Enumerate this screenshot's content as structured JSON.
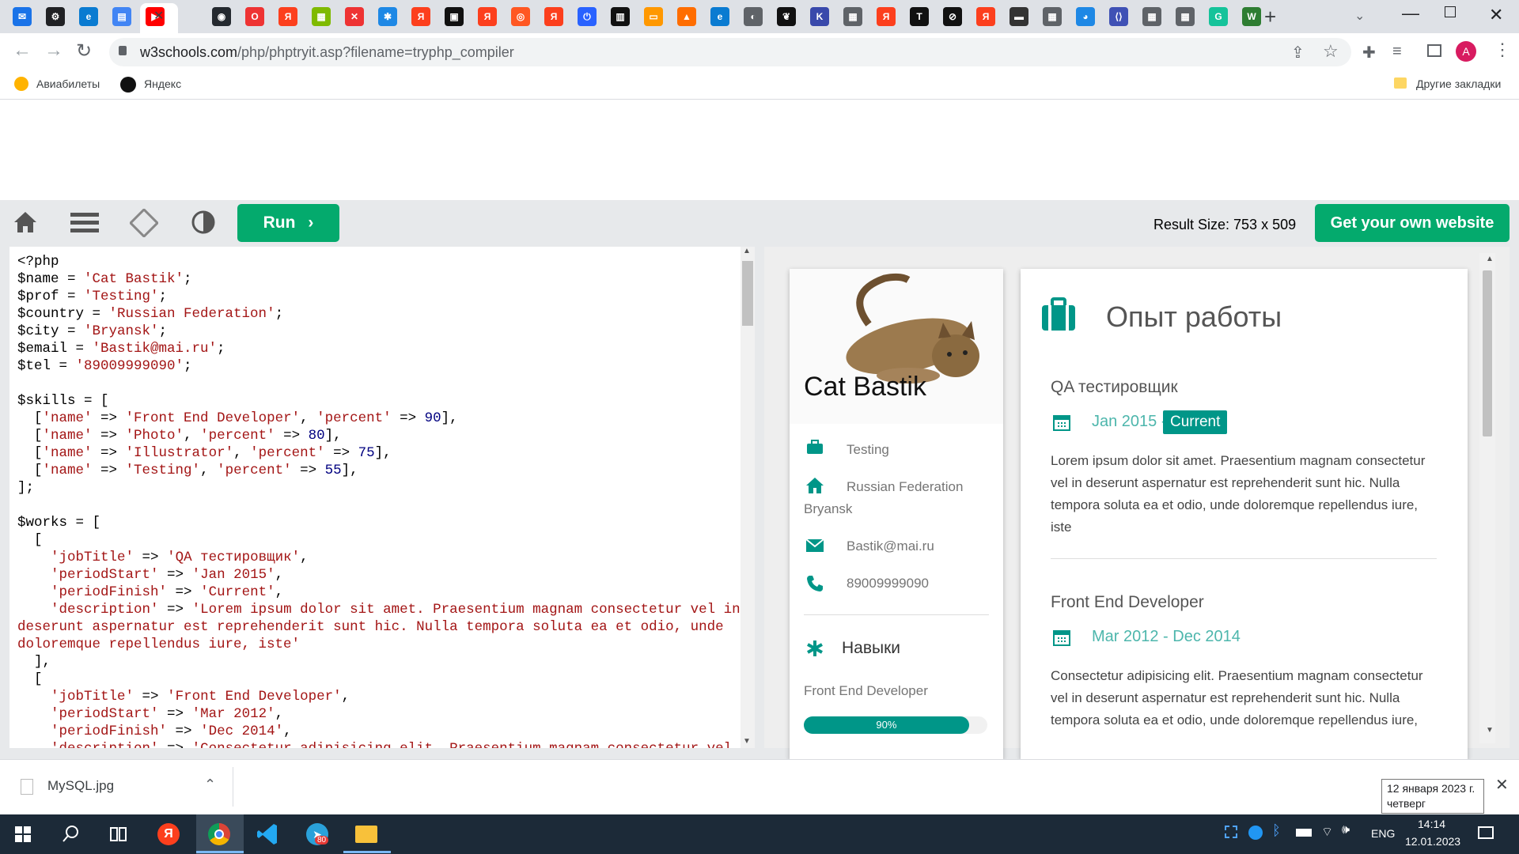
{
  "browser": {
    "url_domain": "w3schools.com",
    "url_path": "/php/phptryit.asp?filename=tryphp_compiler",
    "profile_initial": "A",
    "bookmarks": [
      {
        "label": "Авиабилеты",
        "icon": "plane-icon"
      },
      {
        "label": "Яндекс",
        "icon": "yandex-icon"
      }
    ],
    "other_bookmarks": "Другие закладки",
    "tab_icons": [
      {
        "icon": "mail-icon",
        "color": "#1a73e8",
        "glyph": "✉"
      },
      {
        "icon": "openai-icon",
        "color": "#202124",
        "glyph": "⚙"
      },
      {
        "icon": "edge-icon",
        "color": "#0a7bd1",
        "glyph": "e"
      },
      {
        "icon": "docs-icon",
        "color": "#4285f4",
        "glyph": "▤"
      },
      {
        "icon": "youtube-icon",
        "color": "#ff0000",
        "glyph": "▶"
      },
      {
        "icon": "github-icon",
        "color": "#24292f",
        "glyph": "◉"
      },
      {
        "icon": "opera-icon",
        "color": "#e33",
        "glyph": "O"
      },
      {
        "icon": "yandex-icon",
        "color": "#fc3f1d",
        "glyph": "Я"
      },
      {
        "icon": "microsoft-icon",
        "color": "#7fba00",
        "glyph": "▦"
      },
      {
        "icon": "duo-icon",
        "color": "#e33",
        "glyph": "✕"
      },
      {
        "icon": "app-icon",
        "color": "#1e88e5",
        "glyph": "✱"
      },
      {
        "icon": "yandex-icon",
        "color": "#fc3f1d",
        "glyph": "Я"
      },
      {
        "icon": "terminal-icon",
        "color": "#111",
        "glyph": "▣"
      },
      {
        "icon": "yandex-icon",
        "color": "#fc3f1d",
        "glyph": "Я"
      },
      {
        "icon": "search-circle-icon",
        "color": "#ff5722",
        "glyph": "◎"
      },
      {
        "icon": "yandex-icon",
        "color": "#fc3f1d",
        "glyph": "Я"
      },
      {
        "icon": "power-icon",
        "color": "#2962ff",
        "glyph": "⏻"
      },
      {
        "icon": "dictionary-icon",
        "color": "#111",
        "glyph": "▥"
      },
      {
        "icon": "slides-icon",
        "color": "#ff9800",
        "glyph": "▭"
      },
      {
        "icon": "grid-icon",
        "color": "#ff6d00",
        "glyph": "▲"
      },
      {
        "icon": "edge-icon",
        "color": "#0a7bd1",
        "glyph": "e"
      },
      {
        "icon": "globe-icon",
        "color": "#5f6368",
        "glyph": "◐"
      },
      {
        "icon": "leaf-icon",
        "color": "#111",
        "glyph": "❦"
      },
      {
        "icon": "kotlin-icon",
        "color": "#3949ab",
        "glyph": "K"
      },
      {
        "icon": "grid-icon",
        "color": "#5f6368",
        "glyph": "▦"
      },
      {
        "icon": "yandex-icon",
        "color": "#fc3f1d",
        "glyph": "Я"
      },
      {
        "icon": "text-icon",
        "color": "#111",
        "glyph": "T"
      },
      {
        "icon": "ban-icon",
        "color": "#111",
        "glyph": "⊘"
      },
      {
        "icon": "yandex-icon",
        "color": "#fc3f1d",
        "glyph": "Я"
      },
      {
        "icon": "screen-icon",
        "color": "#333",
        "glyph": "▬"
      },
      {
        "icon": "grid-icon",
        "color": "#5f6368",
        "glyph": "▦"
      },
      {
        "icon": "globe-icon",
        "color": "#1e88e5",
        "glyph": "◕"
      },
      {
        "icon": "code-icon",
        "color": "#3f51b5",
        "glyph": "⟨⟩"
      },
      {
        "icon": "grid-icon",
        "color": "#5f6368",
        "glyph": "▦"
      },
      {
        "icon": "grid-icon",
        "color": "#5f6368",
        "glyph": "▦"
      },
      {
        "icon": "grammarly-icon",
        "color": "#15c39a",
        "glyph": "G"
      },
      {
        "icon": "w-icon",
        "color": "#2e7d32",
        "glyph": "W"
      }
    ]
  },
  "w3": {
    "run_label": "Run",
    "result_size": "Result Size: 753 x 509",
    "get_website": "Get your own website"
  },
  "code_lines": [
    [
      [
        "<?php",
        "t"
      ]
    ],
    [
      [
        "$name = ",
        "t"
      ],
      [
        "'Cat Bastik'",
        "s"
      ],
      [
        ";",
        "t"
      ]
    ],
    [
      [
        "$prof = ",
        "t"
      ],
      [
        "'Testing'",
        "s"
      ],
      [
        ";",
        "t"
      ]
    ],
    [
      [
        "$country = ",
        "t"
      ],
      [
        "'Russian Federation'",
        "s"
      ],
      [
        ";",
        "t"
      ]
    ],
    [
      [
        "$city = ",
        "t"
      ],
      [
        "'Bryansk'",
        "s"
      ],
      [
        ";",
        "t"
      ]
    ],
    [
      [
        "$email = ",
        "t"
      ],
      [
        "'Bastik@mai.ru'",
        "s"
      ],
      [
        ";",
        "t"
      ]
    ],
    [
      [
        "$tel = ",
        "t"
      ],
      [
        "'89009999090'",
        "s"
      ],
      [
        ";",
        "t"
      ]
    ],
    [
      [
        "",
        "t"
      ]
    ],
    [
      [
        "$skills = [",
        "t"
      ]
    ],
    [
      [
        "  [",
        "t"
      ],
      [
        "'name'",
        "s"
      ],
      [
        " => ",
        "t"
      ],
      [
        "'Front End Developer'",
        "s"
      ],
      [
        ", ",
        "t"
      ],
      [
        "'percent'",
        "s"
      ],
      [
        " => ",
        "t"
      ],
      [
        "90",
        "n"
      ],
      [
        "],",
        "t"
      ]
    ],
    [
      [
        "  [",
        "t"
      ],
      [
        "'name'",
        "s"
      ],
      [
        " => ",
        "t"
      ],
      [
        "'Photo'",
        "s"
      ],
      [
        ", ",
        "t"
      ],
      [
        "'percent'",
        "s"
      ],
      [
        " => ",
        "t"
      ],
      [
        "80",
        "n"
      ],
      [
        "],",
        "t"
      ]
    ],
    [
      [
        "  [",
        "t"
      ],
      [
        "'name'",
        "s"
      ],
      [
        " => ",
        "t"
      ],
      [
        "'Illustrator'",
        "s"
      ],
      [
        ", ",
        "t"
      ],
      [
        "'percent'",
        "s"
      ],
      [
        " => ",
        "t"
      ],
      [
        "75",
        "n"
      ],
      [
        "],",
        "t"
      ]
    ],
    [
      [
        "  [",
        "t"
      ],
      [
        "'name'",
        "s"
      ],
      [
        " => ",
        "t"
      ],
      [
        "'Testing'",
        "s"
      ],
      [
        ", ",
        "t"
      ],
      [
        "'percent'",
        "s"
      ],
      [
        " => ",
        "t"
      ],
      [
        "55",
        "n"
      ],
      [
        "],",
        "t"
      ]
    ],
    [
      [
        "];",
        "t"
      ]
    ],
    [
      [
        "",
        "t"
      ]
    ],
    [
      [
        "$works = [",
        "t"
      ]
    ],
    [
      [
        "  [",
        "t"
      ]
    ],
    [
      [
        "    ",
        "t"
      ],
      [
        "'jobTitle'",
        "s"
      ],
      [
        " => ",
        "t"
      ],
      [
        "'QA тестировщик'",
        "s"
      ],
      [
        ",",
        "t"
      ]
    ],
    [
      [
        "    ",
        "t"
      ],
      [
        "'periodStart'",
        "s"
      ],
      [
        " => ",
        "t"
      ],
      [
        "'Jan 2015'",
        "s"
      ],
      [
        ",",
        "t"
      ]
    ],
    [
      [
        "    ",
        "t"
      ],
      [
        "'periodFinish'",
        "s"
      ],
      [
        " => ",
        "t"
      ],
      [
        "'Current'",
        "s"
      ],
      [
        ",",
        "t"
      ]
    ],
    [
      [
        "    ",
        "t"
      ],
      [
        "'description'",
        "s"
      ],
      [
        " => ",
        "t"
      ],
      [
        "'Lorem ipsum dolor sit amet. Praesentium magnam consectetur vel in",
        "s"
      ]
    ],
    [
      [
        "deserunt aspernatur est reprehenderit sunt hic. Nulla tempora soluta ea et odio, unde",
        "s"
      ]
    ],
    [
      [
        "doloremque repellendus iure, iste'",
        "s"
      ]
    ],
    [
      [
        "  ],",
        "t"
      ]
    ],
    [
      [
        "  [",
        "t"
      ]
    ],
    [
      [
        "    ",
        "t"
      ],
      [
        "'jobTitle'",
        "s"
      ],
      [
        " => ",
        "t"
      ],
      [
        "'Front End Developer'",
        "s"
      ],
      [
        ",",
        "t"
      ]
    ],
    [
      [
        "    ",
        "t"
      ],
      [
        "'periodStart'",
        "s"
      ],
      [
        " => ",
        "t"
      ],
      [
        "'Mar 2012'",
        "s"
      ],
      [
        ",",
        "t"
      ]
    ],
    [
      [
        "    ",
        "t"
      ],
      [
        "'periodFinish'",
        "s"
      ],
      [
        " => ",
        "t"
      ],
      [
        "'Dec 2014'",
        "s"
      ],
      [
        ",",
        "t"
      ]
    ],
    [
      [
        "    ",
        "t"
      ],
      [
        "'description'",
        "s"
      ],
      [
        " => ",
        "t"
      ],
      [
        "'Consectetur adipisicing elit. Praesentium magnam consectetur vel",
        "s"
      ]
    ]
  ],
  "profile": {
    "name": "Cat Bastik",
    "prof": "Testing",
    "country": "Russian Federation",
    "city": "Bryansk",
    "email": "Bastik@mai.ru",
    "tel": "89009999090",
    "skills_title": "Навыки",
    "skill_name": "Front End Developer",
    "skill_percent": 90,
    "skill_label": "90%"
  },
  "experience": {
    "title": "Опыт работы",
    "jobs": [
      {
        "title": "QA тестировщик",
        "start": "Jan 2015 -",
        "finish": "Current",
        "description": "Lorem ipsum dolor sit amet. Praesentium magnam consectetur vel in deserunt aspernatur est reprehenderit sunt hic. Nulla tempora soluta ea et odio, unde doloremque repellendus iure, iste"
      },
      {
        "title": "Front End Developer",
        "period": "Mar 2012 - Dec 2014",
        "description": "Consectetur adipisicing elit. Praesentium magnam consectetur vel in deserunt aspernatur est reprehenderit sunt hic. Nulla tempora soluta ea et odio, unde doloremque repellendus iure,"
      }
    ]
  },
  "downloads": {
    "file": "MySQL.jpg"
  },
  "tooltip": {
    "date": "12 января 2023 г.",
    "day": "четверг"
  },
  "taskbar": {
    "lang": "ENG",
    "time": "14:14",
    "date": "12.01.2023",
    "telegram_badge": "80"
  },
  "colors": {
    "accent": "#04aa6d",
    "teal": "#009688",
    "taskbar": "#1c2a38"
  }
}
